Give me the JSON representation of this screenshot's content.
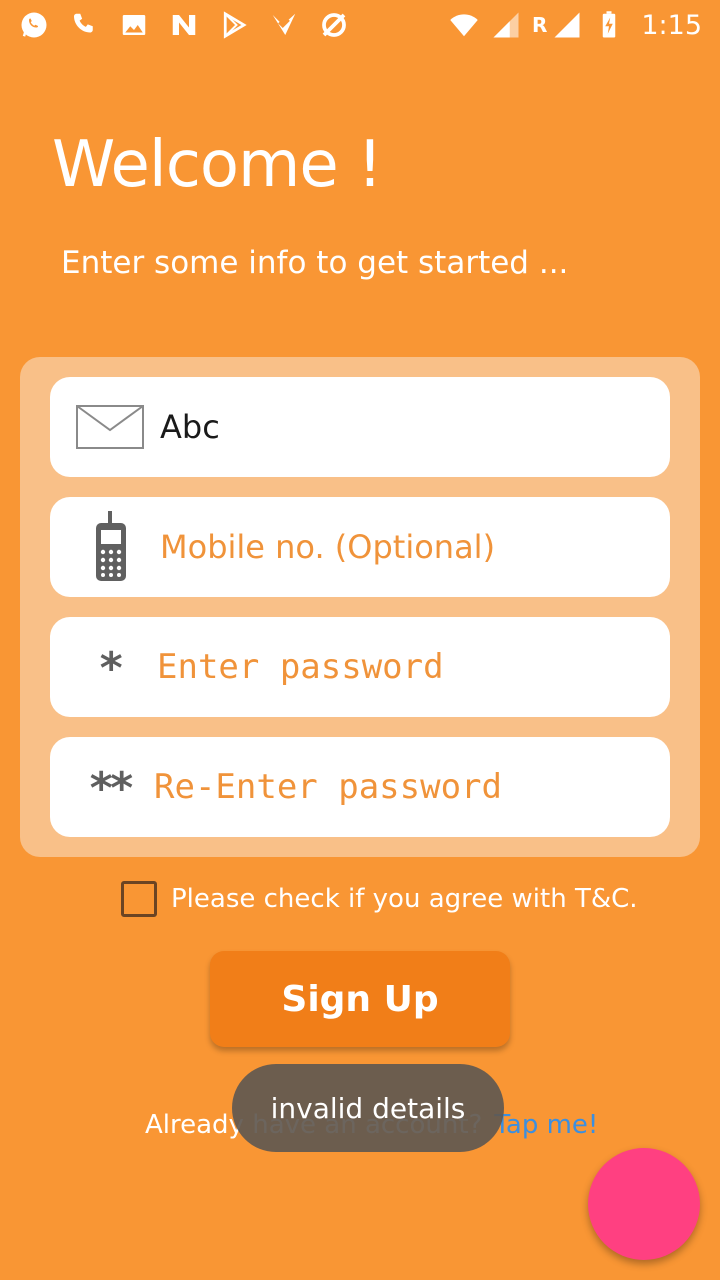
{
  "status_bar": {
    "left_icons": [
      "whatsapp-icon",
      "phone-icon",
      "image-icon",
      "n-app-icon",
      "play-store-icon",
      "checkmark-app-icon",
      "muted-icon"
    ],
    "roaming": "R",
    "time": "1:15"
  },
  "header": {
    "title": "Welcome !",
    "subtitle": "Enter some info to get started ..."
  },
  "form": {
    "email": {
      "icon": "envelope-icon",
      "value": "Abc"
    },
    "mobile": {
      "icon": "mobile-phone-icon",
      "placeholder": "Mobile no. (Optional)"
    },
    "password": {
      "icon_text": "*",
      "placeholder": "Enter password"
    },
    "repassword": {
      "icon_text": "**",
      "placeholder": "Re-Enter password"
    }
  },
  "terms": {
    "checked": false,
    "label": "Please check if you agree with T&C."
  },
  "signup_button": {
    "label": "Sign Up"
  },
  "login": {
    "prompt": "Already have an account?",
    "link": "Tap me!"
  },
  "toast": {
    "text": "invalid details"
  },
  "colors": {
    "background": "#F99634",
    "panel": "#F9C088",
    "button": "#F17E18",
    "placeholder": "#F0933A",
    "link": "#3b8fe0",
    "fab": "#FF4081"
  }
}
